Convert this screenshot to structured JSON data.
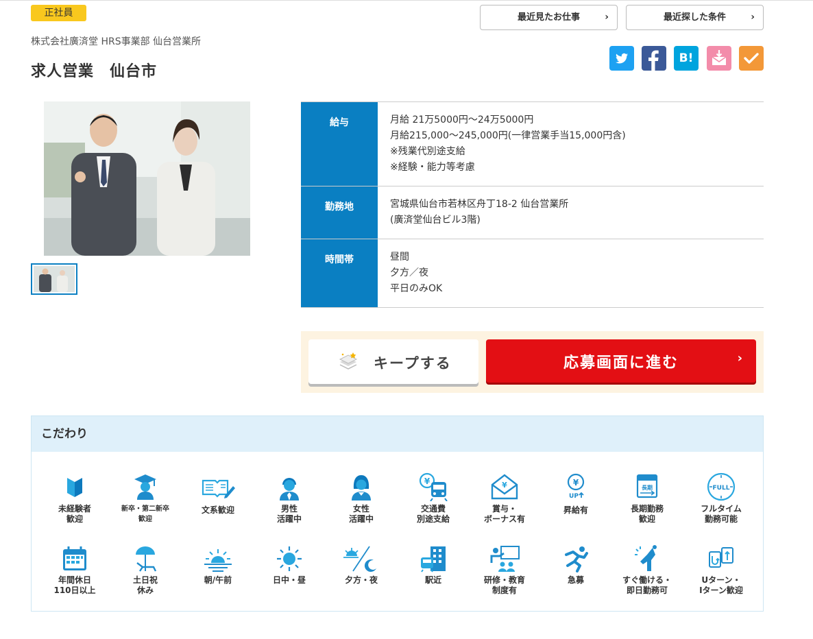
{
  "job": {
    "badge": "正社員",
    "company": "株式会社廣済堂 HRS事業部 仙台営業所",
    "title": "求人営業　仙台市"
  },
  "history": {
    "recent_jobs": "最近見たお仕事",
    "recent_search": "最近探した条件"
  },
  "share": {
    "twitter": "twitter-icon",
    "facebook": "facebook-icon",
    "hatena": "B!",
    "mail": "mail-icon",
    "check": "check-icon",
    "colors": {
      "twitter": "#1da1f2",
      "facebook": "#3b5998",
      "hatena": "#00a4de",
      "mail": "#f38caa",
      "check": "#f39838"
    }
  },
  "details": {
    "salary": {
      "label": "給与",
      "lines": [
        "月給 21万5000円～24万5000円",
        "月給215,000～245,000円(一律営業手当15,000円含)",
        "※残業代別途支給",
        "※経験・能力等考慮"
      ]
    },
    "location": {
      "label": "勤務地",
      "lines": [
        "宮城県仙台市若林区舟丁18-2 仙台営業所",
        "(廣済堂仙台ビル3階)"
      ]
    },
    "hours": {
      "label": "時間帯",
      "lines": [
        "昼間",
        "夕方／夜",
        "平日のみOK"
      ]
    }
  },
  "actions": {
    "keep": "キープする",
    "apply": "応募画面に進む"
  },
  "kodawari": {
    "title": "こだわり",
    "items": [
      {
        "label": "未経験者\n歓迎",
        "icon": "beginner-mark-icon"
      },
      {
        "label": "新卒・第二新卒\n歓迎",
        "icon": "graduate-icon"
      },
      {
        "label": "文系歓迎",
        "icon": "book-pen-icon"
      },
      {
        "label": "男性\n活躍中",
        "icon": "man-icon"
      },
      {
        "label": "女性\n活躍中",
        "icon": "woman-icon"
      },
      {
        "label": "交通費\n別途支給",
        "icon": "yen-train-icon"
      },
      {
        "label": "賞与・\nボーナス有",
        "icon": "bonus-envelope-icon"
      },
      {
        "label": "昇給有",
        "icon": "yen-up-icon"
      },
      {
        "label": "長期勤務\n歓迎",
        "icon": "long-term-icon"
      },
      {
        "label": "フルタイム\n勤務可能",
        "icon": "full-clock-icon"
      },
      {
        "label": "年間休日\n110日以上",
        "icon": "calendar-icon"
      },
      {
        "label": "土日祝\n休み",
        "icon": "beach-chair-icon"
      },
      {
        "label": "朝/午前",
        "icon": "sunrise-icon"
      },
      {
        "label": "日中・昼",
        "icon": "sun-icon"
      },
      {
        "label": "夕方・夜",
        "icon": "sun-moon-icon"
      },
      {
        "label": "駅近",
        "icon": "station-building-icon"
      },
      {
        "label": "研修・教育\n制度有",
        "icon": "training-icon"
      },
      {
        "label": "急募",
        "icon": "running-icon"
      },
      {
        "label": "すぐ働ける・\n即日勤務可",
        "icon": "immediate-icon"
      },
      {
        "label": "Uターン・\nIターン歓迎",
        "icon": "u-turn-icon"
      }
    ]
  }
}
